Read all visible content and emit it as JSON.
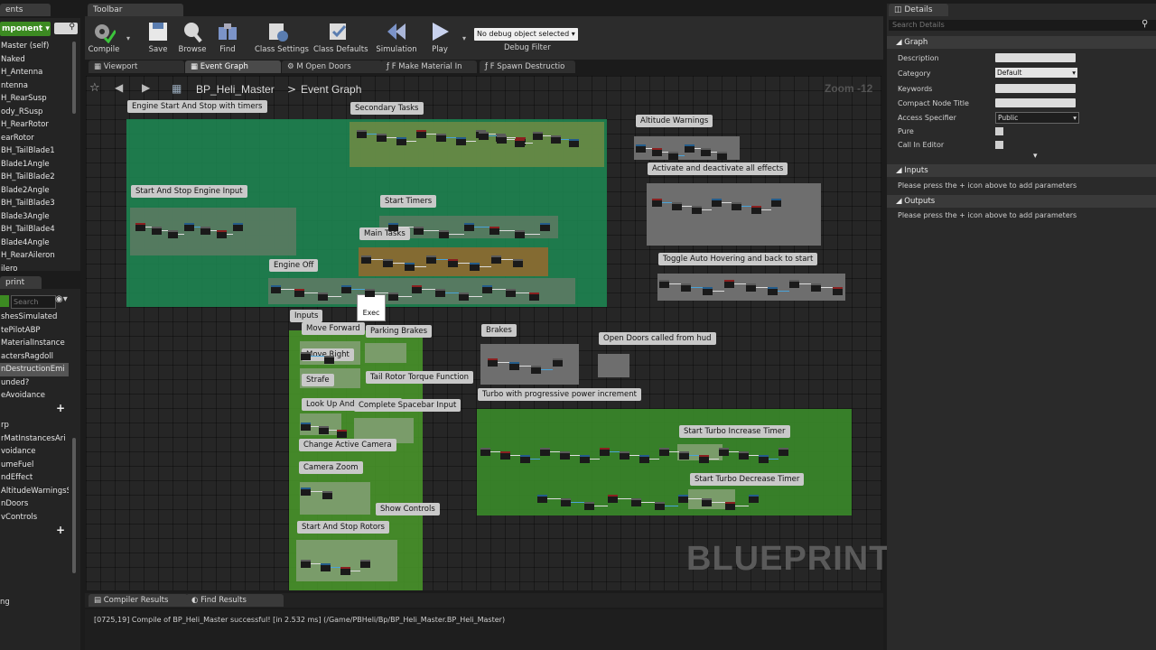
{
  "left_panel": {
    "tab_label": "ents",
    "add_component_label": "mponent ▾",
    "items": [
      "Master (self)",
      "Naked",
      "H_Antenna",
      "ntenna",
      "H_RearSusp",
      "ody_RSusp",
      "H_RearRotor",
      "earRotor",
      "BH_TailBlade1",
      "Blade1Angle",
      "BH_TailBlade2",
      "Blade2Angle",
      "BH_TailBlade3",
      "Blade3Angle",
      "BH_TailBlade4",
      "Blade4Angle",
      "H_RearAileron",
      "ilero"
    ],
    "bp_tab_label": "print",
    "search_placeholder": "Search",
    "vars": [
      "shesSimulated",
      "tePilotABP",
      "MaterialInstance",
      "actersRagdoll",
      "nDestructionEmi",
      "unded?",
      "eAvoidance"
    ],
    "funcs": [
      "rp",
      "rMatInstancesAri",
      "voidance",
      "umeFuel",
      "ndEffect",
      "AltitudeWarningsS",
      "nDoors",
      "vControls"
    ],
    "bottom_label": "ng"
  },
  "toolbar": {
    "tab_label": "Toolbar",
    "buttons": [
      {
        "label": "Compile",
        "icon": "compile-icon"
      },
      {
        "label": "Save",
        "icon": "save-icon"
      },
      {
        "label": "Browse",
        "icon": "browse-icon"
      },
      {
        "label": "Find",
        "icon": "find-icon"
      },
      {
        "label": "Class Settings",
        "icon": "class-settings-icon"
      },
      {
        "label": "Class Defaults",
        "icon": "class-defaults-icon"
      },
      {
        "label": "Simulation",
        "icon": "simulation-icon"
      },
      {
        "label": "Play",
        "icon": "play-icon"
      }
    ],
    "debug_object": "No debug object selected ▾",
    "debug_filter": "Debug Filter"
  },
  "doc_tabs": [
    {
      "label": "Viewport"
    },
    {
      "label": "Event Graph"
    },
    {
      "label": "M Open Doors"
    },
    {
      "label": "F Make Material In"
    },
    {
      "label": "F Spawn Destructio"
    }
  ],
  "breadcrumb": {
    "blueprint": "BP_Heli_Master",
    "separator": ">",
    "graph": "Event Graph"
  },
  "zoom": "Zoom -12",
  "watermark": "BLUEPRINT",
  "comments": {
    "engine": "Engine Start And Stop with timers",
    "secondary": "Secondary Tasks",
    "start_stop_input": "Start And Stop Engine Input",
    "start_timers": "Start Timers",
    "main_tasks": "Main Tasks",
    "engine_off": "Engine Off",
    "altitude": "Altitude Warnings",
    "effects": "Activate and deactivate all effects",
    "hover": "Toggle Auto Hovering and back to start",
    "inputs": "Inputs",
    "move_forward": "Move Forward",
    "move_right": "Move Right",
    "strafe": "Strafe",
    "look": "Look Up And Look Right",
    "parking": "Parking Brakes",
    "tail_rotor": "Tail Rotor Torque Function",
    "spacebar": "Complete Spacebar Input",
    "camera": "Change Active Camera",
    "cam_zoom": "Camera Zoom",
    "show_controls": "Show Controls",
    "start_stop_rotors": "Start And Stop Rotors",
    "brakes": "Brakes",
    "open_doors": "Open Doors called from hud",
    "turbo": "Turbo with progressive power increment",
    "turbo_inc": "Start Turbo Increase Timer",
    "turbo_dec": "Start Turbo Decrease Timer",
    "exec_tooltip": "Exec"
  },
  "details": {
    "tab_label": "Details",
    "search_placeholder": "Search Details",
    "graph_section": "Graph",
    "rows": {
      "description": "Description",
      "category": "Category",
      "category_value": "Default",
      "keywords": "Keywords",
      "compact": "Compact Node Title",
      "access": "Access Specifier",
      "access_value": "Public",
      "pure": "Pure",
      "call_editor": "Call In Editor"
    },
    "inputs_section": "Inputs",
    "inputs_hint": "Please press the + icon above to add parameters",
    "outputs_section": "Outputs",
    "outputs_hint": "Please press the + icon above to add parameters"
  },
  "bottom": {
    "compiler_tab": "Compiler Results",
    "find_tab": "Find Results",
    "log_line": "[0725,19] Compile of BP_Heli_Master successful! [in 2.532 ms] (/Game/PBHeli/Bp/BP_Heli_Master.BP_Heli_Master)"
  },
  "colors": {
    "comment_green": "#1f8a4f",
    "input_green": "#4a9a2a",
    "compile_green": "#3c8a22"
  }
}
